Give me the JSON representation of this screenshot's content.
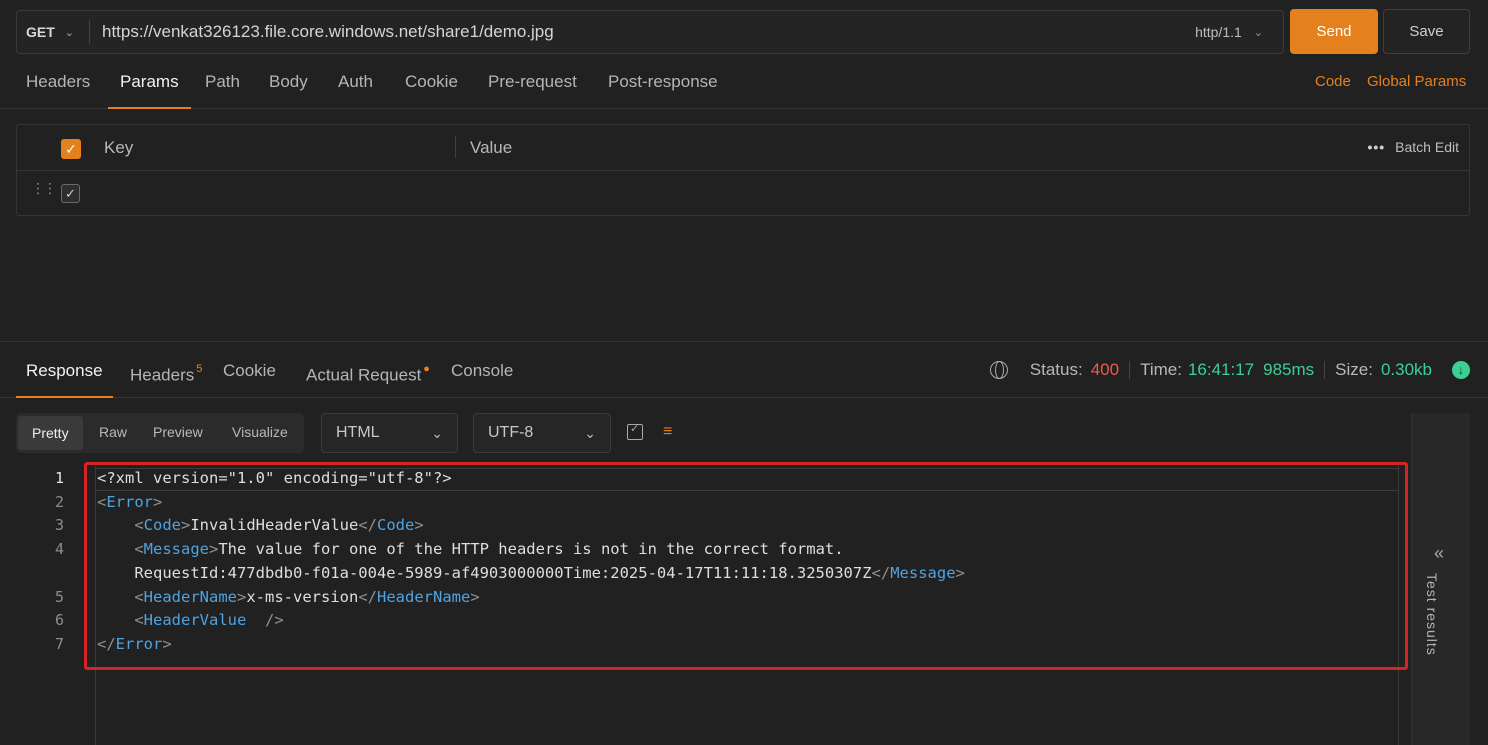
{
  "request": {
    "method": "GET",
    "url": "https://venkat326123.file.core.windows.net/share1/demo.jpg",
    "protocol": "http/1.1",
    "send_label": "Send",
    "save_label": "Save"
  },
  "request_tabs": [
    "Headers",
    "Params",
    "Path",
    "Body",
    "Auth",
    "Cookie",
    "Pre-request",
    "Post-response"
  ],
  "request_links": {
    "code": "Code",
    "global_params": "Global Params"
  },
  "params": {
    "key_header": "Key",
    "value_header": "Value",
    "batch_edit": "Batch Edit"
  },
  "response_tabs": {
    "response": "Response",
    "headers": "Headers",
    "headers_count": "5",
    "cookie": "Cookie",
    "actual_request": "Actual Request",
    "console": "Console"
  },
  "status": {
    "status_label": "Status:",
    "status_value": "400",
    "time_label": "Time:",
    "time_value": "16:41:17",
    "duration": "985ms",
    "size_label": "Size:",
    "size_value": "0.30kb"
  },
  "view_modes": [
    "Pretty",
    "Raw",
    "Preview",
    "Visualize"
  ],
  "format": "HTML",
  "encoding": "UTF-8",
  "side_panel": {
    "label": "Test results"
  },
  "code_lines": [
    {
      "num": "1",
      "text": "<?xml version=\"1.0\" encoding=\"utf-8\"?>"
    },
    {
      "num": "2",
      "open": "Error"
    },
    {
      "num": "3",
      "tag": "Code",
      "value": "InvalidHeaderValue"
    },
    {
      "num": "4",
      "tag": "Message",
      "value": "The value for one of the HTTP headers is not in the correct format."
    },
    {
      "num": "",
      "value": "RequestId:477dbdb0-f01a-004e-5989-af4903000000Time:2025-04-17T11:11:18.3250307Z",
      "close": "Message"
    },
    {
      "num": "5",
      "tag": "HeaderName",
      "value": "x-ms-version"
    },
    {
      "num": "6",
      "selfclose": "HeaderValue"
    },
    {
      "num": "7",
      "closeonly": "Error"
    }
  ],
  "colors": {
    "accent": "#e5811d",
    "status_error": "#f05a4a",
    "ok_green": "#3ccf94",
    "xml_tag": "#4fa3e0"
  }
}
